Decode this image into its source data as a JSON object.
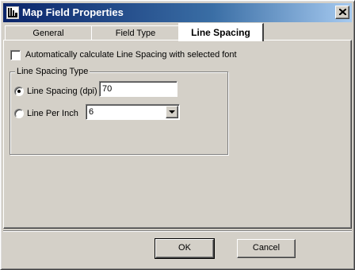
{
  "window": {
    "title": "Map Field Properties",
    "close_symbol": "×"
  },
  "tabs": [
    {
      "label": "General",
      "active": false
    },
    {
      "label": "Field Type",
      "active": false
    },
    {
      "label": "Line Spacing",
      "active": true
    }
  ],
  "line_spacing": {
    "auto_calc_label": "Automatically calculate Line Spacing with selected font",
    "auto_calc_checked": false,
    "group_label": "Line Spacing Type",
    "dpi_option": {
      "label": "Line Spacing (dpi)",
      "selected": true,
      "value": "70"
    },
    "lpi_option": {
      "label": "Line Per Inch",
      "selected": false,
      "value": "6"
    }
  },
  "buttons": {
    "ok": "OK",
    "cancel": "Cancel"
  },
  "icons": {
    "app": "app-logo-icon",
    "close": "close-icon",
    "dropdown": "chevron-down-icon"
  }
}
